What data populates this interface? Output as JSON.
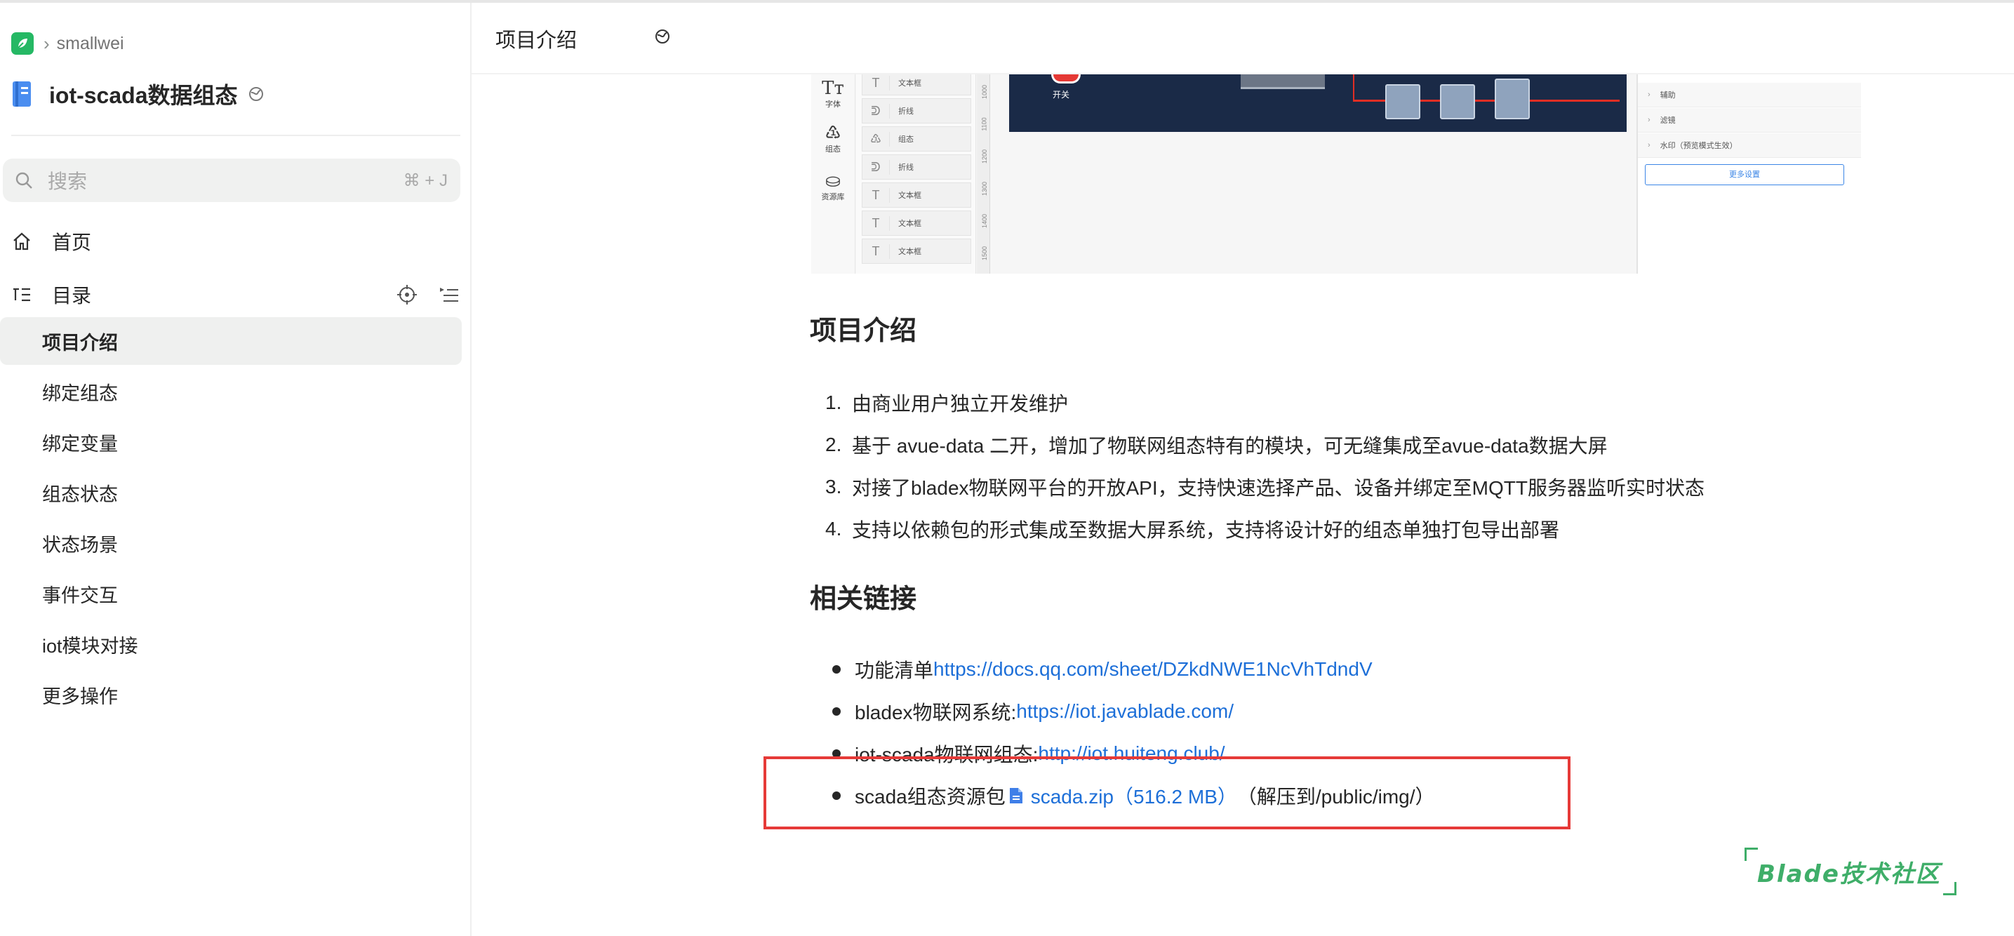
{
  "sidebar": {
    "breadcrumb_user": "smallwei",
    "book_title": "iot-scada数据组态",
    "search": {
      "placeholder": "搜索",
      "shortcut": "⌘ + J"
    },
    "home_label": "首页",
    "toc_label": "目录",
    "toc_items": [
      {
        "label": "项目介绍",
        "active": true
      },
      {
        "label": "绑定组态"
      },
      {
        "label": "绑定变量"
      },
      {
        "label": "组态状态"
      },
      {
        "label": "状态场景"
      },
      {
        "label": "事件交互"
      },
      {
        "label": "iot模块对接"
      },
      {
        "label": "更多操作"
      }
    ]
  },
  "header": {
    "title": "项目介绍"
  },
  "embedded_screenshot": {
    "tools": [
      "字体",
      "组态",
      "资源库"
    ],
    "tool_glyphs": [
      "Tт",
      "♳",
      "⛀"
    ],
    "layers": [
      {
        "glyph": "T",
        "label": "文本框"
      },
      {
        "glyph": "ᕲ",
        "label": "折线"
      },
      {
        "glyph": "♳",
        "label": "组态"
      },
      {
        "glyph": "ᕲ",
        "label": "折线"
      },
      {
        "glyph": "T",
        "label": "文本框"
      },
      {
        "glyph": "T",
        "label": "文本框"
      },
      {
        "glyph": "T",
        "label": "文本框"
      }
    ],
    "ruler_numbers": [
      "1000",
      "1100",
      "1200",
      "1300",
      "1400",
      "1500"
    ],
    "switch_label": "开关",
    "right_panel_rows": [
      "辅助",
      "滤镜",
      "水印（预览模式生效）"
    ],
    "right_panel_button": "更多设置"
  },
  "article": {
    "section1_title": "项目介绍",
    "section1_items": [
      "由商业用户独立开发维护",
      "基于 avue-data 二开，增加了物联网组态特有的模块，可无缝集成至avue-data数据大屏",
      "对接了bladex物联网平台的开放API，支持快速选择产品、设备并绑定至MQTT服务器监听实时状态",
      "支持以依赖包的形式集成至数据大屏系统，支持将设计好的组态单独打包导出部署"
    ],
    "section2_title": "相关链接",
    "links": [
      {
        "prefix": "功能清单",
        "url": "https://docs.qq.com/sheet/DZkdNWE1NcVhTdndV"
      },
      {
        "prefix": "bladex物联网系统:",
        "url": "https://iot.javablade.com/"
      },
      {
        "prefix": "iot-scada物联网组态:",
        "url": "http://iot.huiteng.club/"
      }
    ],
    "resource": {
      "prefix": "scada组态资源包",
      "file_name": "scada.zip",
      "file_size": "（516.2 MB）",
      "suffix": "（解压到/public/img/）"
    }
  },
  "watermark": "Blade技术社区",
  "colors": {
    "link": "#1d6fd8",
    "highlight_box": "#e63a38",
    "watermark": "#3fae69",
    "logo": "#25b864"
  }
}
